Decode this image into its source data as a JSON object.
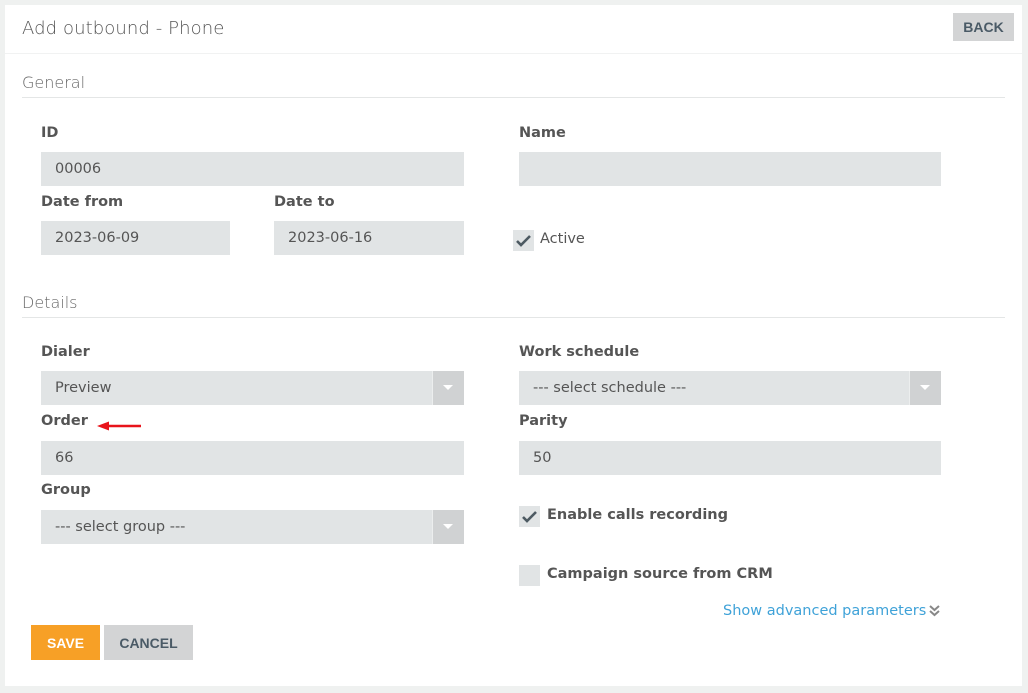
{
  "header": {
    "title": "Add outbound - Phone",
    "back_label": "BACK"
  },
  "general": {
    "section_title": "General",
    "id": {
      "label": "ID",
      "value": "00006"
    },
    "name": {
      "label": "Name",
      "value": ""
    },
    "date_from": {
      "label": "Date from",
      "value": "2023-06-09"
    },
    "date_to": {
      "label": "Date to",
      "value": "2023-06-16"
    },
    "active": {
      "label": "Active",
      "checked": true
    }
  },
  "details": {
    "section_title": "Details",
    "dialer": {
      "label": "Dialer",
      "value": "Preview"
    },
    "work_schedule": {
      "label": "Work schedule",
      "value": "--- select schedule ---"
    },
    "order": {
      "label": "Order",
      "value": "66"
    },
    "parity": {
      "label": "Parity",
      "value": "50"
    },
    "group": {
      "label": "Group",
      "value": "--- select group ---"
    },
    "enable_calls_recording": {
      "label": "Enable calls recording",
      "checked": true
    },
    "campaign_source_crm": {
      "label": "Campaign source from CRM",
      "checked": false
    },
    "advanced_link": "Show advanced parameters"
  },
  "footer": {
    "save_label": "SAVE",
    "cancel_label": "CANCEL"
  },
  "annotation": {
    "icon": "red-arrow-left",
    "color": "#e8141b"
  },
  "colors": {
    "save": "#f7a026",
    "link": "#3fa2d8",
    "field_bg": "#e1e4e5"
  }
}
